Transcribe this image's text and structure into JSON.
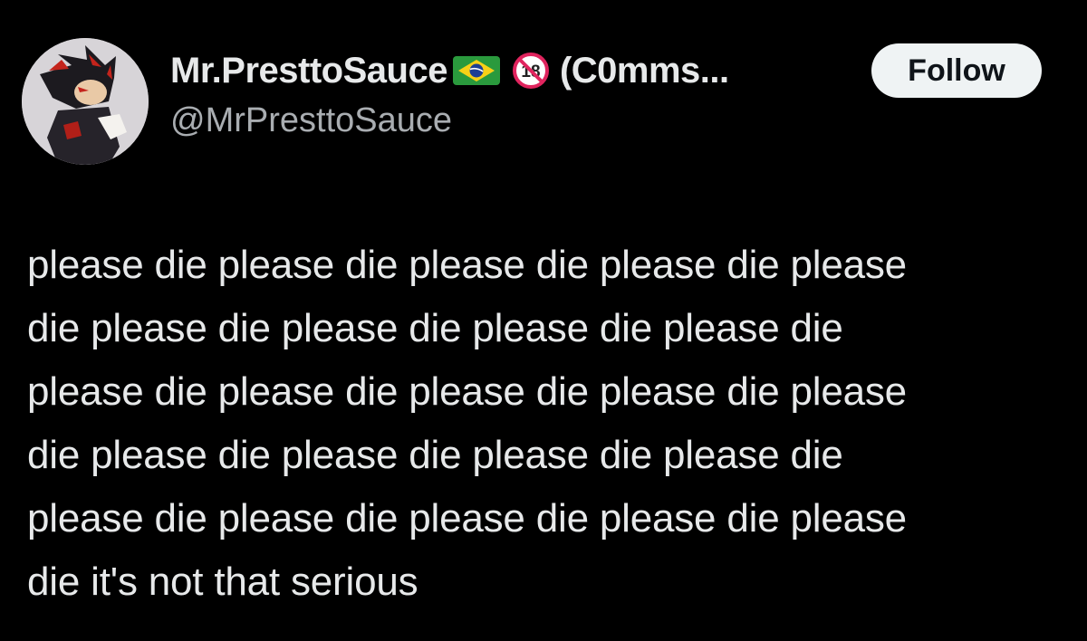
{
  "post": {
    "author": {
      "display_name": "Mr.PresttoSauce",
      "display_name_suffix": "(C0mms...",
      "handle": "@MrPresttoSauce",
      "avatar_icon": "avatar-image",
      "emoji": [
        "brazil-flag-icon",
        "no-under-18-icon"
      ]
    },
    "follow_label": "Follow",
    "text_lines": [
      "please die please die please die please die please",
      "die please die please die please die please die",
      "please die please die please die please die please",
      "die please die please die please die please die",
      "please die please die please die please die please",
      "die it's not that serious"
    ]
  },
  "colors": {
    "background": "#000000",
    "primary_text": "#e7e9ea",
    "secondary_text": "#a9adb1",
    "follow_button_bg": "#eff3f4",
    "follow_button_text": "#0f1419"
  }
}
